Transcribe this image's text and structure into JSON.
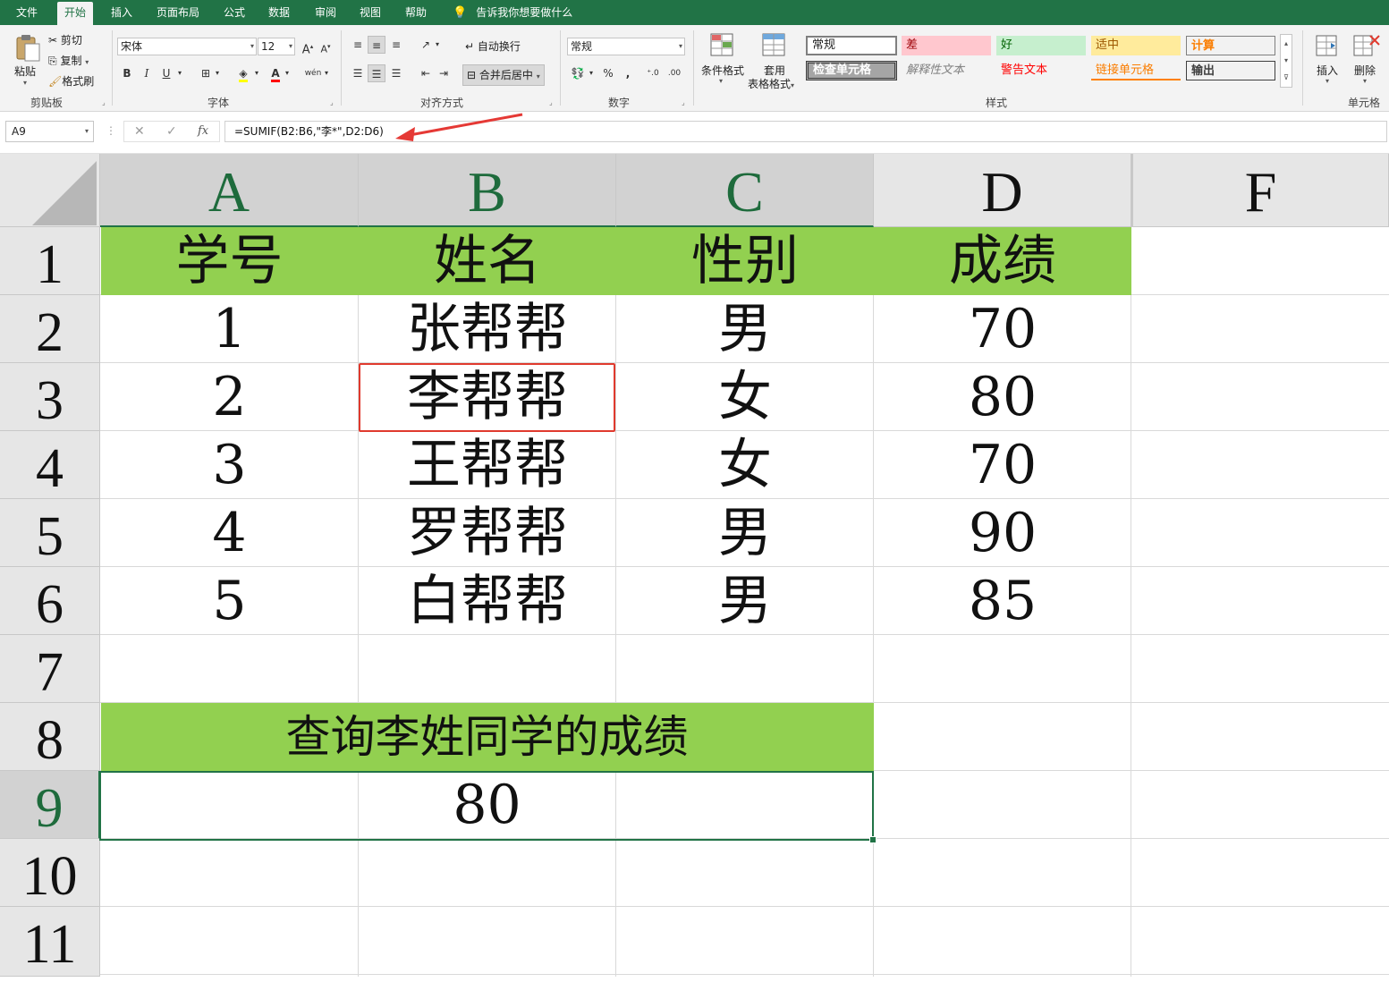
{
  "menu": {
    "tabs": [
      "文件",
      "开始",
      "插入",
      "页面布局",
      "公式",
      "数据",
      "审阅",
      "视图",
      "帮助"
    ],
    "active_tab": "开始",
    "tell_me": "告诉我你想要做什么"
  },
  "ribbon": {
    "clipboard": {
      "paste": "粘贴",
      "cut": "剪切",
      "copy": "复制",
      "format_painter": "格式刷",
      "label": "剪贴板"
    },
    "font": {
      "font_name": "宋体",
      "font_size": "12",
      "bold": "B",
      "italic": "I",
      "underline": "U",
      "label": "字体",
      "phonetic": "wén"
    },
    "alignment": {
      "wrap_text": "自动换行",
      "merge_center": "合并后居中",
      "label": "对齐方式"
    },
    "number": {
      "format": "常规",
      "percent": "%",
      "comma": ",",
      "label": "数字"
    },
    "styles": {
      "conditional_format": "条件格式",
      "table_format_1": "套用",
      "table_format_2": "表格格式",
      "cells": [
        {
          "text": "常规",
          "bg": "#ffffff",
          "color": "#000000"
        },
        {
          "text": "差",
          "bg": "#ffc7ce",
          "color": "#9c0006"
        },
        {
          "text": "好",
          "bg": "#c6efce",
          "color": "#006100"
        },
        {
          "text": "适中",
          "bg": "#ffeb9c",
          "color": "#9c5700"
        },
        {
          "text": "计算",
          "bg": "#f2f2f2",
          "color": "#fa7d00"
        },
        {
          "text": "检查单元格",
          "bg": "#a5a5a5",
          "color": "#ffffff"
        },
        {
          "text": "解释性文本",
          "bg": "#f3f3f3",
          "color": "#7f7f7f"
        },
        {
          "text": "警告文本",
          "bg": "#f3f3f3",
          "color": "#ff0000"
        },
        {
          "text": "链接单元格",
          "bg": "#f3f3f3",
          "color": "#fa7d00"
        },
        {
          "text": "输出",
          "bg": "#f2f2f2",
          "color": "#3f3f3f"
        }
      ],
      "label": "样式"
    },
    "cells_group": {
      "insert": "插入",
      "delete": "删除",
      "label": "单元格"
    }
  },
  "formula_bar": {
    "name_box": "A9",
    "cancel_icon": "✕",
    "enter_icon": "✓",
    "fx": "fx",
    "formula": "=SUMIF(B2:B6,\"李*\",D2:D6)"
  },
  "sheet": {
    "columns": [
      "A",
      "B",
      "C",
      "D",
      "F"
    ],
    "rows": [
      "1",
      "2",
      "3",
      "4",
      "5",
      "6",
      "7",
      "8",
      "9",
      "10",
      "11"
    ],
    "header_row": [
      "学号",
      "姓名",
      "性别",
      "成绩"
    ],
    "data": [
      [
        "1",
        "张帮帮",
        "男",
        "70"
      ],
      [
        "2",
        "李帮帮",
        "女",
        "80"
      ],
      [
        "3",
        "王帮帮",
        "女",
        "70"
      ],
      [
        "4",
        "罗帮帮",
        "男",
        "90"
      ],
      [
        "5",
        "白帮帮",
        "男",
        "85"
      ]
    ],
    "query_label": "查询李姓同学的成绩",
    "query_result": "80",
    "accent_green": "#92d050",
    "selected_cell": "A9"
  }
}
